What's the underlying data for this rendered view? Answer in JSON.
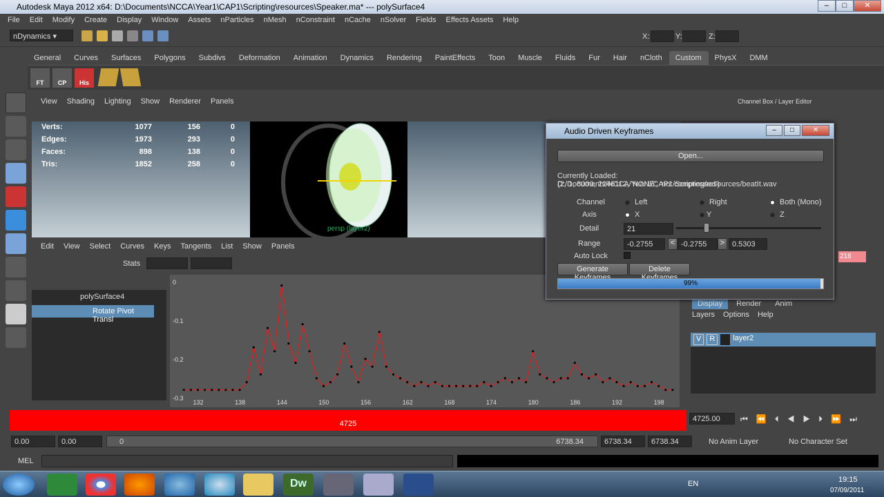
{
  "window": {
    "title": "Autodesk Maya 2012 x64: D:\\Documents\\NCCA\\Year1\\CAP1\\Scripting\\resources\\Speaker.ma*   ---   polySurface4"
  },
  "menus": [
    "File",
    "Edit",
    "Modify",
    "Create",
    "Display",
    "Window",
    "Assets",
    "nParticles",
    "nMesh",
    "nConstraint",
    "nCache",
    "nSolver",
    "Fields",
    "Effects Assets",
    "Help"
  ],
  "status": {
    "menuset": "nDynamics",
    "x_label": "X:",
    "y_label": "Y:",
    "z_label": "Z:"
  },
  "shelf": {
    "tabs": [
      "General",
      "Curves",
      "Surfaces",
      "Polygons",
      "Subdivs",
      "Deformation",
      "Animation",
      "Dynamics",
      "Rendering",
      "PaintEffects",
      "Toon",
      "Muscle",
      "Fluids",
      "Fur",
      "Hair",
      "nCloth",
      "Custom",
      "PhysX",
      "DMM"
    ],
    "active": "Custom",
    "buttons": [
      "FT",
      "CP",
      "His"
    ]
  },
  "viewport": {
    "menu": [
      "View",
      "Shading",
      "Lighting",
      "Show",
      "Renderer",
      "Panels"
    ],
    "hud": [
      {
        "label": "Verts:",
        "a": "1077",
        "b": "156",
        "c": "0"
      },
      {
        "label": "Edges:",
        "a": "1973",
        "b": "293",
        "c": "0"
      },
      {
        "label": "Faces:",
        "a": "898",
        "b": "138",
        "c": "0"
      },
      {
        "label": "Tris:",
        "a": "1852",
        "b": "258",
        "c": "0"
      }
    ],
    "cam_label": "persp (layer2)"
  },
  "graph_editor": {
    "menu": [
      "Edit",
      "View",
      "Select",
      "Curves",
      "Keys",
      "Tangents",
      "List",
      "Show",
      "Panels"
    ],
    "stats_label": "Stats",
    "outliner": [
      "polySurface4",
      "Rotate Pivot Transl"
    ],
    "y_ticks": [
      "0",
      "-0.1",
      "-0.2",
      "-0.3"
    ],
    "x_ticks": [
      "132",
      "138",
      "144",
      "150",
      "156",
      "162",
      "168",
      "174",
      "180",
      "186",
      "192",
      "198"
    ]
  },
  "timeline": {
    "value": "4725",
    "current": "4725.00"
  },
  "range": {
    "start1": "0.00",
    "start2": "0.00",
    "slider_start": "0",
    "slider_end": "6738.34",
    "end1": "6738.34",
    "end2": "6738.34",
    "anim_layer": "No Anim Layer",
    "char_set": "No Character Set"
  },
  "cmdline": {
    "label": "MEL"
  },
  "right_panel": {
    "title": "Channel Box / Layer Editor",
    "tabs": [
      "Display",
      "Render",
      "Anim"
    ],
    "menu": [
      "Layers",
      "Options",
      "Help"
    ],
    "layer": {
      "v": "V",
      "r": "R",
      "name": "layer2"
    },
    "value": "218"
  },
  "dialog": {
    "title": "Audio Driven Keyframes",
    "open_btn": "Open...",
    "loaded": "Currently Loaded: D:/Documents/NCCA/Year1/CAP1/Scripting/resources/beatIt.wav",
    "info": "(2, 1, 8000, 2246112, 'NONE', 'not compressed')",
    "channel_label": "Channel",
    "channels": [
      "Left",
      "Right",
      "Both (Mono)"
    ],
    "axis_label": "Axis",
    "axes": [
      "X",
      "Y",
      "Z"
    ],
    "detail_label": "Detail",
    "detail": "21",
    "range_label": "Range",
    "range_min": "-0.2755",
    "range_cur": "-0.2755",
    "range_max": "0.5303",
    "lt": "<",
    "gt": ">",
    "autolock_label": "Auto Lock",
    "gen_btn": "Generate Keyframes",
    "del_btn": "Delete Keyframes",
    "progress": "99%",
    "progress_value": 0.99
  },
  "taskbar": {
    "lang": "EN",
    "time": "19:15",
    "date": "07/09/2011"
  },
  "chart_data": {
    "type": "line",
    "x": [
      130,
      131,
      132,
      133,
      134,
      135,
      136,
      137,
      138,
      139,
      140,
      141,
      142,
      143,
      144,
      145,
      146,
      147,
      148,
      149,
      150,
      151,
      152,
      153,
      154,
      155,
      156,
      157,
      158,
      159,
      160,
      161,
      162,
      163,
      164,
      165,
      166,
      167,
      168,
      169,
      170,
      171,
      172,
      173,
      174,
      175,
      176,
      177,
      178,
      179,
      180,
      181,
      182,
      183,
      184,
      185,
      186,
      187,
      188,
      189,
      190,
      191,
      192,
      193,
      194,
      195,
      196,
      197,
      198,
      199,
      200
    ],
    "y": [
      -0.28,
      -0.28,
      -0.28,
      -0.28,
      -0.28,
      -0.28,
      -0.28,
      -0.28,
      -0.28,
      -0.26,
      -0.17,
      -0.24,
      -0.12,
      -0.18,
      -0.01,
      -0.16,
      -0.21,
      -0.11,
      -0.18,
      -0.25,
      -0.27,
      -0.26,
      -0.24,
      -0.16,
      -0.22,
      -0.26,
      -0.2,
      -0.22,
      -0.13,
      -0.22,
      -0.24,
      -0.25,
      -0.26,
      -0.27,
      -0.26,
      -0.27,
      -0.26,
      -0.27,
      -0.27,
      -0.27,
      -0.27,
      -0.27,
      -0.27,
      -0.26,
      -0.27,
      -0.26,
      -0.25,
      -0.26,
      -0.25,
      -0.26,
      -0.18,
      -0.24,
      -0.25,
      -0.26,
      -0.25,
      -0.25,
      -0.21,
      -0.24,
      -0.25,
      -0.24,
      -0.26,
      -0.25,
      -0.26,
      -0.27,
      -0.26,
      -0.27,
      -0.27,
      -0.26,
      -0.27,
      -0.28,
      -0.28
    ],
    "ylim": [
      -0.3,
      0
    ],
    "xlim": [
      128,
      201
    ]
  }
}
